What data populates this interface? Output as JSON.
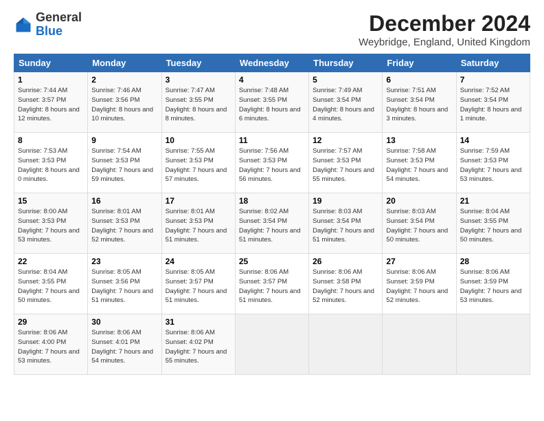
{
  "header": {
    "logo_general": "General",
    "logo_blue": "Blue",
    "month_title": "December 2024",
    "subtitle": "Weybridge, England, United Kingdom"
  },
  "days_of_week": [
    "Sunday",
    "Monday",
    "Tuesday",
    "Wednesday",
    "Thursday",
    "Friday",
    "Saturday"
  ],
  "weeks": [
    [
      {
        "day": "1",
        "sunrise": "7:44 AM",
        "sunset": "3:57 PM",
        "daylight": "8 hours and 12 minutes."
      },
      {
        "day": "2",
        "sunrise": "7:46 AM",
        "sunset": "3:56 PM",
        "daylight": "8 hours and 10 minutes."
      },
      {
        "day": "3",
        "sunrise": "7:47 AM",
        "sunset": "3:55 PM",
        "daylight": "8 hours and 8 minutes."
      },
      {
        "day": "4",
        "sunrise": "7:48 AM",
        "sunset": "3:55 PM",
        "daylight": "8 hours and 6 minutes."
      },
      {
        "day": "5",
        "sunrise": "7:49 AM",
        "sunset": "3:54 PM",
        "daylight": "8 hours and 4 minutes."
      },
      {
        "day": "6",
        "sunrise": "7:51 AM",
        "sunset": "3:54 PM",
        "daylight": "8 hours and 3 minutes."
      },
      {
        "day": "7",
        "sunrise": "7:52 AM",
        "sunset": "3:54 PM",
        "daylight": "8 hours and 1 minute."
      }
    ],
    [
      {
        "day": "8",
        "sunrise": "7:53 AM",
        "sunset": "3:53 PM",
        "daylight": "8 hours and 0 minutes."
      },
      {
        "day": "9",
        "sunrise": "7:54 AM",
        "sunset": "3:53 PM",
        "daylight": "7 hours and 59 minutes."
      },
      {
        "day": "10",
        "sunrise": "7:55 AM",
        "sunset": "3:53 PM",
        "daylight": "7 hours and 57 minutes."
      },
      {
        "day": "11",
        "sunrise": "7:56 AM",
        "sunset": "3:53 PM",
        "daylight": "7 hours and 56 minutes."
      },
      {
        "day": "12",
        "sunrise": "7:57 AM",
        "sunset": "3:53 PM",
        "daylight": "7 hours and 55 minutes."
      },
      {
        "day": "13",
        "sunrise": "7:58 AM",
        "sunset": "3:53 PM",
        "daylight": "7 hours and 54 minutes."
      },
      {
        "day": "14",
        "sunrise": "7:59 AM",
        "sunset": "3:53 PM",
        "daylight": "7 hours and 53 minutes."
      }
    ],
    [
      {
        "day": "15",
        "sunrise": "8:00 AM",
        "sunset": "3:53 PM",
        "daylight": "7 hours and 53 minutes."
      },
      {
        "day": "16",
        "sunrise": "8:01 AM",
        "sunset": "3:53 PM",
        "daylight": "7 hours and 52 minutes."
      },
      {
        "day": "17",
        "sunrise": "8:01 AM",
        "sunset": "3:53 PM",
        "daylight": "7 hours and 51 minutes."
      },
      {
        "day": "18",
        "sunrise": "8:02 AM",
        "sunset": "3:54 PM",
        "daylight": "7 hours and 51 minutes."
      },
      {
        "day": "19",
        "sunrise": "8:03 AM",
        "sunset": "3:54 PM",
        "daylight": "7 hours and 51 minutes."
      },
      {
        "day": "20",
        "sunrise": "8:03 AM",
        "sunset": "3:54 PM",
        "daylight": "7 hours and 50 minutes."
      },
      {
        "day": "21",
        "sunrise": "8:04 AM",
        "sunset": "3:55 PM",
        "daylight": "7 hours and 50 minutes."
      }
    ],
    [
      {
        "day": "22",
        "sunrise": "8:04 AM",
        "sunset": "3:55 PM",
        "daylight": "7 hours and 50 minutes."
      },
      {
        "day": "23",
        "sunrise": "8:05 AM",
        "sunset": "3:56 PM",
        "daylight": "7 hours and 51 minutes."
      },
      {
        "day": "24",
        "sunrise": "8:05 AM",
        "sunset": "3:57 PM",
        "daylight": "7 hours and 51 minutes."
      },
      {
        "day": "25",
        "sunrise": "8:06 AM",
        "sunset": "3:57 PM",
        "daylight": "7 hours and 51 minutes."
      },
      {
        "day": "26",
        "sunrise": "8:06 AM",
        "sunset": "3:58 PM",
        "daylight": "7 hours and 52 minutes."
      },
      {
        "day": "27",
        "sunrise": "8:06 AM",
        "sunset": "3:59 PM",
        "daylight": "7 hours and 52 minutes."
      },
      {
        "day": "28",
        "sunrise": "8:06 AM",
        "sunset": "3:59 PM",
        "daylight": "7 hours and 53 minutes."
      }
    ],
    [
      {
        "day": "29",
        "sunrise": "8:06 AM",
        "sunset": "4:00 PM",
        "daylight": "7 hours and 53 minutes."
      },
      {
        "day": "30",
        "sunrise": "8:06 AM",
        "sunset": "4:01 PM",
        "daylight": "7 hours and 54 minutes."
      },
      {
        "day": "31",
        "sunrise": "8:06 AM",
        "sunset": "4:02 PM",
        "daylight": "7 hours and 55 minutes."
      },
      null,
      null,
      null,
      null
    ]
  ]
}
